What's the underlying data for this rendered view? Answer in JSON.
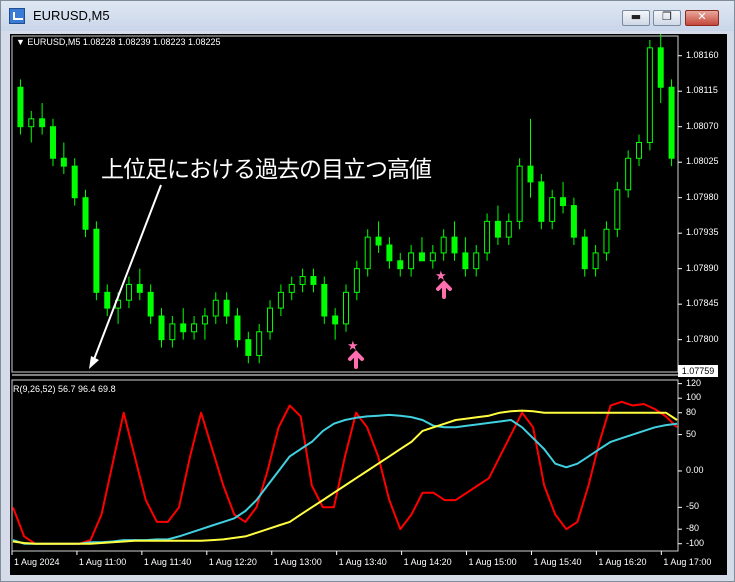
{
  "window": {
    "title": "EURUSD,M5",
    "minimize_label": "▬",
    "maximize_label": "❐",
    "close_label": "✕"
  },
  "chart": {
    "info_text": "▼ EURUSD,M5  1.08228 1.08239 1.08223 1.08225",
    "annotation": "上位足における過去の目立つ高値",
    "current_price": "1.07759",
    "price_ticks": [
      "1.08160",
      "1.08115",
      "1.08070",
      "1.08025",
      "1.07980",
      "1.07935",
      "1.07890",
      "1.07845",
      "1.07800"
    ],
    "time_ticks": [
      "1 Aug 2024",
      "1 Aug 11:00",
      "1 Aug 11:40",
      "1 Aug 12:20",
      "1 Aug 13:00",
      "1 Aug 13:40",
      "1 Aug 14:20",
      "1 Aug 15:00",
      "1 Aug 15:40",
      "1 Aug 16:20",
      "1 Aug 17:00"
    ],
    "indicator_info": "R(9,26,52) 56.7 96.4 69.8",
    "indicator_ticks": [
      "120",
      "100",
      "80",
      "50",
      "0.00",
      "-50",
      "-80",
      "-100"
    ],
    "colors": {
      "background": "#000000",
      "candle": "#00ff00",
      "line_red": "#ff0000",
      "line_cyan": "#40d0e0",
      "line_yellow": "#ffff40",
      "marker": "#ff6fb0"
    }
  },
  "chart_data": [
    {
      "type": "candlestick",
      "title": "EURUSD,M5",
      "ylim": [
        1.07759,
        1.08185
      ],
      "candles": [
        [
          1.0812,
          1.0813,
          1.0806,
          1.0807
        ],
        [
          1.0807,
          1.0809,
          1.0805,
          1.0808
        ],
        [
          1.0808,
          1.081,
          1.0806,
          1.0807
        ],
        [
          1.0807,
          1.0808,
          1.0802,
          1.0803
        ],
        [
          1.0803,
          1.0805,
          1.0801,
          1.0802
        ],
        [
          1.0802,
          1.0803,
          1.0797,
          1.0798
        ],
        [
          1.0798,
          1.0799,
          1.0793,
          1.0794
        ],
        [
          1.0794,
          1.0795,
          1.0785,
          1.0786
        ],
        [
          1.0786,
          1.0787,
          1.0783,
          1.0784
        ],
        [
          1.0784,
          1.0786,
          1.0782,
          1.0785
        ],
        [
          1.0785,
          1.0788,
          1.0784,
          1.0787
        ],
        [
          1.0787,
          1.0789,
          1.0785,
          1.0786
        ],
        [
          1.0786,
          1.0787,
          1.0782,
          1.0783
        ],
        [
          1.0783,
          1.0784,
          1.0779,
          1.078
        ],
        [
          1.078,
          1.0783,
          1.0779,
          1.0782
        ],
        [
          1.0782,
          1.0784,
          1.078,
          1.0781
        ],
        [
          1.0781,
          1.0783,
          1.078,
          1.0782
        ],
        [
          1.0782,
          1.0784,
          1.078,
          1.0783
        ],
        [
          1.0783,
          1.0786,
          1.0782,
          1.0785
        ],
        [
          1.0785,
          1.0786,
          1.0782,
          1.0783
        ],
        [
          1.0783,
          1.0784,
          1.0779,
          1.078
        ],
        [
          1.078,
          1.0781,
          1.0777,
          1.0778
        ],
        [
          1.0778,
          1.0782,
          1.0777,
          1.0781
        ],
        [
          1.0781,
          1.0785,
          1.078,
          1.0784
        ],
        [
          1.0784,
          1.0787,
          1.0783,
          1.0786
        ],
        [
          1.0786,
          1.0788,
          1.0785,
          1.0787
        ],
        [
          1.0787,
          1.0789,
          1.0786,
          1.0788
        ],
        [
          1.0788,
          1.0789,
          1.0786,
          1.0787
        ],
        [
          1.0787,
          1.0788,
          1.0782,
          1.0783
        ],
        [
          1.0783,
          1.0784,
          1.078,
          1.0782
        ],
        [
          1.0782,
          1.0787,
          1.0781,
          1.0786
        ],
        [
          1.0786,
          1.079,
          1.0785,
          1.0789
        ],
        [
          1.0789,
          1.0794,
          1.0788,
          1.0793
        ],
        [
          1.0793,
          1.0795,
          1.0791,
          1.0792
        ],
        [
          1.0792,
          1.0793,
          1.0789,
          1.079
        ],
        [
          1.079,
          1.0791,
          1.0788,
          1.0789
        ],
        [
          1.0789,
          1.0792,
          1.0788,
          1.0791
        ],
        [
          1.0791,
          1.0793,
          1.079,
          1.079
        ],
        [
          1.079,
          1.0792,
          1.0789,
          1.0791
        ],
        [
          1.0791,
          1.0794,
          1.079,
          1.0793
        ],
        [
          1.0793,
          1.0795,
          1.079,
          1.0791
        ],
        [
          1.0791,
          1.0793,
          1.0788,
          1.0789
        ],
        [
          1.0789,
          1.0792,
          1.0788,
          1.0791
        ],
        [
          1.0791,
          1.0796,
          1.079,
          1.0795
        ],
        [
          1.0795,
          1.0797,
          1.0792,
          1.0793
        ],
        [
          1.0793,
          1.0796,
          1.0792,
          1.0795
        ],
        [
          1.0795,
          1.0803,
          1.0794,
          1.0802
        ],
        [
          1.0802,
          1.0808,
          1.0798,
          1.08
        ],
        [
          1.08,
          1.0801,
          1.0794,
          1.0795
        ],
        [
          1.0795,
          1.0799,
          1.0794,
          1.0798
        ],
        [
          1.0798,
          1.08,
          1.0796,
          1.0797
        ],
        [
          1.0797,
          1.0798,
          1.0792,
          1.0793
        ],
        [
          1.0793,
          1.0794,
          1.0788,
          1.0789
        ],
        [
          1.0789,
          1.0792,
          1.0788,
          1.0791
        ],
        [
          1.0791,
          1.0795,
          1.079,
          1.0794
        ],
        [
          1.0794,
          1.08,
          1.0793,
          1.0799
        ],
        [
          1.0799,
          1.0804,
          1.0798,
          1.0803
        ],
        [
          1.0803,
          1.0806,
          1.0802,
          1.0805
        ],
        [
          1.0805,
          1.0818,
          1.0804,
          1.0817
        ],
        [
          1.0817,
          1.0819,
          1.081,
          1.0812
        ],
        [
          1.0812,
          1.0813,
          1.0802,
          1.0803
        ]
      ]
    },
    {
      "type": "line",
      "title": "R(9,26,52)",
      "ylim": [
        -110,
        125
      ],
      "series": [
        {
          "name": "R9",
          "values": [
            -50,
            -90,
            -100,
            -100,
            -100,
            -100,
            -100,
            -95,
            -60,
            10,
            80,
            20,
            -40,
            -70,
            -70,
            -50,
            20,
            80,
            30,
            -20,
            -60,
            -70,
            -50,
            0,
            60,
            90,
            75,
            -20,
            -50,
            -50,
            20,
            80,
            60,
            20,
            -40,
            -80,
            -60,
            -30,
            -30,
            -40,
            -40,
            -30,
            -20,
            -10,
            20,
            50,
            80,
            60,
            -20,
            -60,
            -80,
            -70,
            -20,
            40,
            90,
            95,
            90,
            92,
            85,
            75,
            60
          ]
        },
        {
          "name": "R26",
          "values": [
            -95,
            -100,
            -100,
            -100,
            -100,
            -100,
            -100,
            -98,
            -98,
            -97,
            -95,
            -95,
            -95,
            -94,
            -94,
            -90,
            -85,
            -80,
            -75,
            -70,
            -65,
            -55,
            -40,
            -20,
            0,
            20,
            30,
            40,
            55,
            65,
            70,
            73,
            75,
            76,
            77,
            76,
            74,
            70,
            62,
            60,
            60,
            62,
            64,
            66,
            68,
            70,
            60,
            45,
            30,
            10,
            5,
            10,
            20,
            30,
            40,
            45,
            50,
            55,
            60,
            63,
            65
          ]
        },
        {
          "name": "R52",
          "values": [
            -97,
            -99,
            -100,
            -100,
            -100,
            -100,
            -100,
            -100,
            -99,
            -98,
            -97,
            -96,
            -96,
            -96,
            -96,
            -96,
            -96,
            -96,
            -95,
            -94,
            -92,
            -90,
            -85,
            -80,
            -75,
            -70,
            -60,
            -50,
            -40,
            -30,
            -20,
            -10,
            0,
            10,
            20,
            30,
            40,
            55,
            60,
            65,
            70,
            72,
            74,
            76,
            80,
            82,
            83,
            82,
            80,
            80,
            80,
            80,
            80,
            80,
            80,
            80,
            80,
            80,
            80,
            80,
            70
          ]
        }
      ]
    }
  ]
}
